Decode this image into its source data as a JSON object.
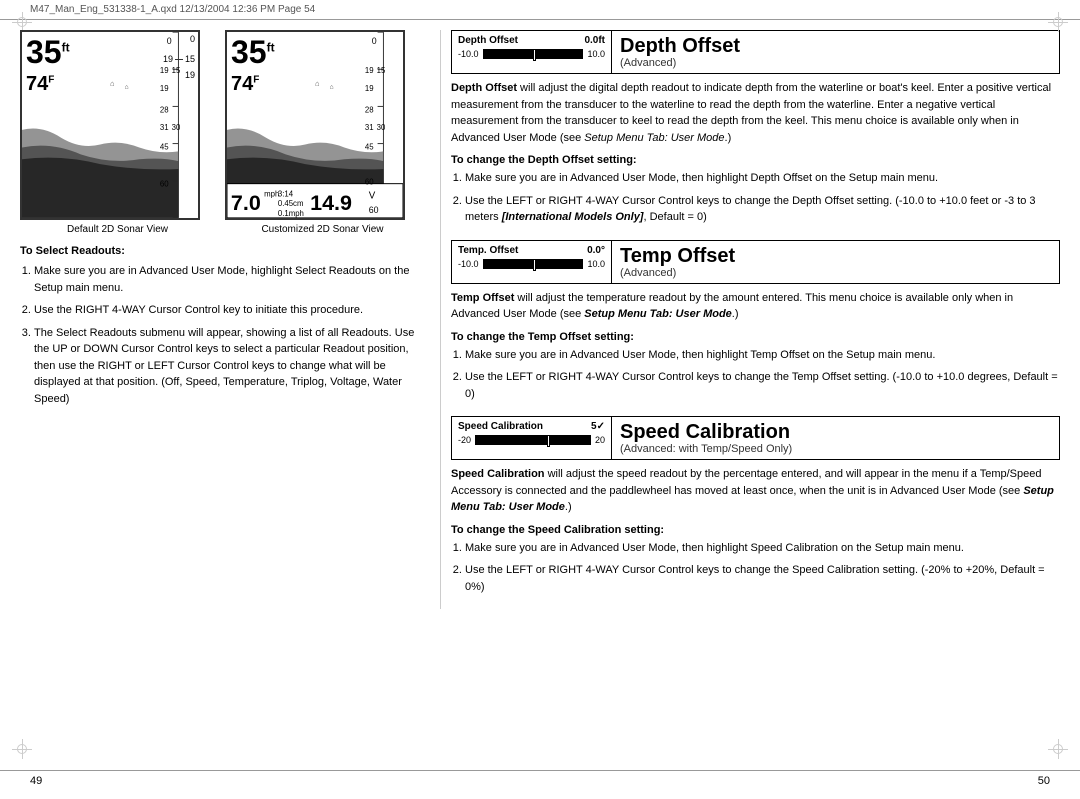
{
  "header": {
    "file_info": "M47_Man_Eng_531338-1_A.qxd  12/13/2004  12:36 PM  Page 54"
  },
  "left": {
    "sonar_views": {
      "default": {
        "title": "Default 2D Sonar View",
        "depth": "35",
        "depth_unit": "ft",
        "temp": "74",
        "temp_unit": "F",
        "scale_0": "0",
        "scale_15": "15",
        "scale_19a": "19",
        "scale_19b": "19",
        "scale_28": "28",
        "scale_31": "31",
        "scale_30": "30",
        "scale_45": "45",
        "scale_60": "60"
      },
      "customized": {
        "title": "Customized 2D Sonar View",
        "depth": "35",
        "depth_unit": "ft",
        "temp": "74",
        "temp_unit": "F",
        "scale_0": "0",
        "scale_15": "15",
        "scale_19a": "19",
        "scale_19b": "19",
        "scale_28": "28",
        "scale_31": "31",
        "scale_30": "30",
        "scale_45": "45",
        "scale_60": "60",
        "time": "3:14",
        "depth_cm": "0.45cm",
        "depth_in": "0.1mph",
        "speed": "7.0",
        "speed_unit": "mph",
        "voltage": "14.9",
        "voltage_unit": "V"
      }
    },
    "select_readouts": {
      "title": "To Select Readouts:",
      "steps": [
        "Make sure you are in Advanced User Mode, highlight Select Readouts on the Setup main menu.",
        "Use the RIGHT 4-WAY Cursor Control key to initiate this procedure.",
        "The Select Readouts submenu will appear, showing a list of all Readouts. Use the UP or DOWN Cursor Control keys to select a particular Readout position, then use the RIGHT or LEFT Cursor Control keys to change what will be displayed at that position. (Off, Speed, Temperature, Triplog, Voltage, Water Speed)"
      ]
    }
  },
  "right": {
    "depth_offset": {
      "control_label1": "Depth Offset",
      "control_value": "0.0ft",
      "range_min": "-10.0",
      "range_max": "10.0",
      "title": "Depth Offset",
      "subtitle": "(Advanced)",
      "description": "Depth Offset will adjust the digital depth readout to indicate depth from the waterline or boat's keel. Enter a positive vertical measurement from the transducer to the waterline to read the depth from the waterline. Enter a negative vertical measurement from the transducer to keel to read the depth from the keel. This menu choice is available only when in Advanced User Mode (see Setup Menu Tab: User Mode.)",
      "change_title": "To change the Depth Offset setting:",
      "steps": [
        "Make sure you are in Advanced User Mode, then highlight Depth Offset on the Setup main menu.",
        "Use the LEFT or RIGHT 4-WAY Cursor Control keys to change the Depth Offset setting. (-10.0 to +10.0 feet or -3 to 3 meters [International Models Only], Default = 0)"
      ]
    },
    "temp_offset": {
      "control_label1": "Temp. Offset",
      "control_value": "0.0°",
      "range_min": "-10.0",
      "range_max": "10.0",
      "title": "Temp Offset",
      "subtitle": "(Advanced)",
      "description": "Temp Offset will adjust the temperature readout by the amount entered. This menu choice is available only when in Advanced User Mode  (see Setup Menu Tab: User Mode.)",
      "change_title": "To change the Temp Offset setting:",
      "steps": [
        "Make sure you are in Advanced User Mode, then highlight Temp Offset on the Setup main menu.",
        "Use the LEFT or RIGHT 4-WAY Cursor Control keys to change the Temp Offset setting. (-10.0 to +10.0 degrees, Default = 0)"
      ]
    },
    "speed_calibration": {
      "control_label1": "Speed Calibration",
      "control_value": "5✓",
      "range_min": "-20",
      "range_max": "20",
      "title": "Speed Calibration",
      "subtitle": "(Advanced: with Temp/Speed Only)",
      "description": "Speed Calibration will adjust the speed readout by the percentage entered, and will appear in the menu if a Temp/Speed Accessory is connected and the paddlewheel has moved at least once, when the unit is in Advanced User Mode (see Setup Menu Tab: User Mode.)",
      "change_title": "To change the Speed Calibration setting:",
      "steps": [
        "Make sure you are in Advanced User Mode, then highlight Speed Calibration on the Setup main menu.",
        "Use the LEFT or RIGHT 4-WAY Cursor Control keys to change the Speed Calibration setting. (-20% to +20%, Default = 0%)"
      ]
    }
  },
  "footer": {
    "page_left": "49",
    "page_right": "50"
  }
}
